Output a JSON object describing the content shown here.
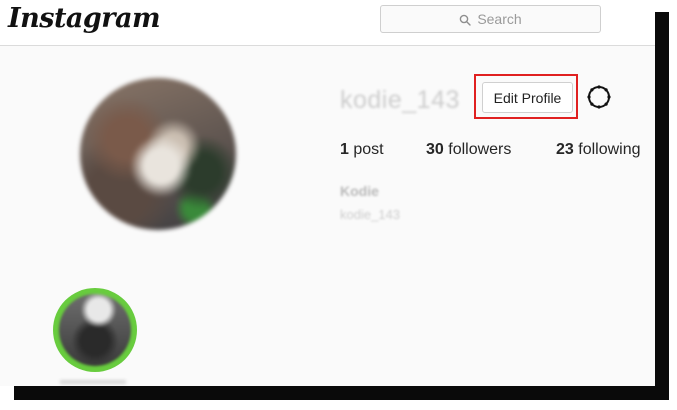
{
  "header": {
    "logo_text": "Instagram",
    "search": {
      "placeholder": "Search",
      "icon": "search-icon"
    }
  },
  "profile": {
    "username": "kodie_143",
    "edit_profile_label": "Edit Profile",
    "settings_icon": "gear-icon",
    "stats": {
      "posts": {
        "count": "1",
        "label": "post"
      },
      "followers": {
        "count": "30",
        "label": "followers"
      },
      "following": {
        "count": "23",
        "label": "following"
      }
    },
    "bio": {
      "name": "Kodie",
      "handle": "kodie_143"
    }
  },
  "colors": {
    "highlight_box": "#e02020",
    "story_ring": "#68cc3e",
    "background": "#fafafa"
  }
}
